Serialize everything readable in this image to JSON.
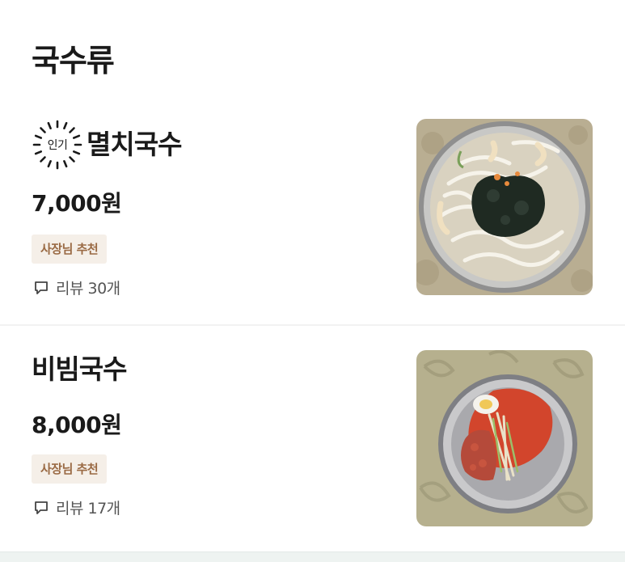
{
  "section": {
    "title": "국수류"
  },
  "items": [
    {
      "badge": "인기",
      "name": "멸치국수",
      "price": "7,000원",
      "tag": "사장님 추천",
      "review": "리뷰 30개",
      "thumb_icon": "anchovy-noodle-photo"
    },
    {
      "name": "비빔국수",
      "price": "8,000원",
      "tag": "사장님 추천",
      "review": "리뷰 17개",
      "thumb_icon": "bibim-noodle-photo"
    }
  ],
  "colors": {
    "tag_bg": "#f5efe8",
    "tag_text": "#9a6a44",
    "text": "#1a1a1a"
  }
}
